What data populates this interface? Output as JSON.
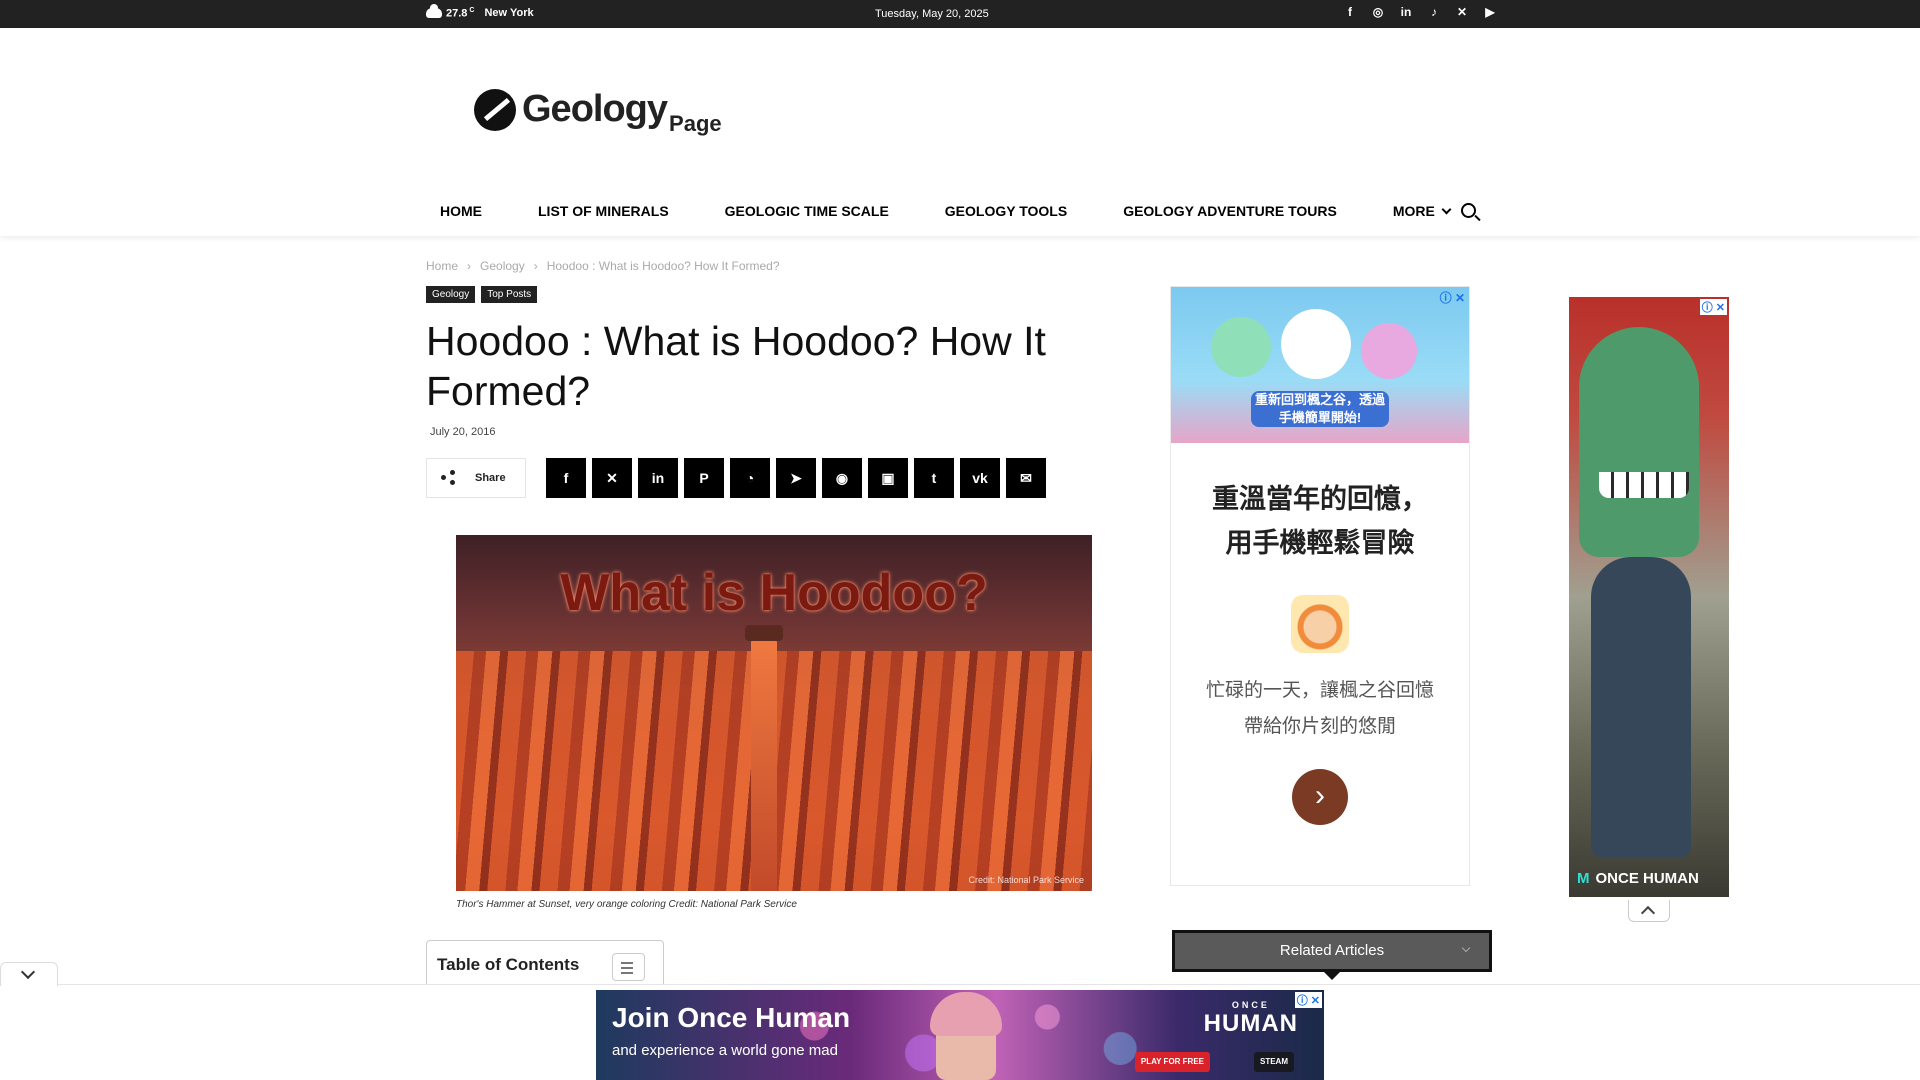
{
  "topbar": {
    "temperature": "27.8",
    "unit": "C",
    "city": "New York",
    "date": "Tuesday, May 20, 2025",
    "social": [
      "f",
      "◎",
      "in",
      "♪",
      "✕",
      "▶"
    ]
  },
  "logo": {
    "main": "Geology",
    "sub": "Page"
  },
  "nav": {
    "items": [
      "HOME",
      "LIST OF MINERALS",
      "GEOLOGIC TIME SCALE",
      "GEOLOGY TOOLS",
      "GEOLOGY ADVENTURE TOURS"
    ],
    "more": "MORE"
  },
  "breadcrumb": [
    "Home",
    "Geology",
    "Hoodoo : What is Hoodoo? How It Formed?"
  ],
  "categories": [
    "Geology",
    "Top Posts"
  ],
  "article": {
    "title": "Hoodoo : What is Hoodoo? How It Formed?",
    "date": "July 20, 2016"
  },
  "share": {
    "label": "Share",
    "buttons": [
      "f",
      "✕",
      "in",
      "P",
      "◔",
      "➤",
      "◉",
      "▣",
      "t",
      "vk",
      "✉"
    ]
  },
  "feature_image": {
    "overlay_text": "What is Hoodoo?",
    "credit": "Credit: National Park Service",
    "caption": "Thor's Hammer at Sunset, very orange coloring Credit: National Park Service"
  },
  "toc": {
    "title": "Table of Contents"
  },
  "ad_right": {
    "banner_text": "重新回到楓之谷，透過手機簡單開始!",
    "headline_line1": "重溫當年的回憶，",
    "headline_line2": "用手機輕鬆冒險",
    "desc_line1": "忙碌的一天，讓楓之谷回憶",
    "desc_line2": "帶給你片刻的悠閒",
    "arrow": "›"
  },
  "ad_skyscraper": {
    "brand": "ONCE HUMAN"
  },
  "related": {
    "label": "Related Articles"
  },
  "bottom_ad": {
    "headline": "Join Once Human",
    "sub": "and experience a world gone mad",
    "brand_small": "ONCE",
    "brand": "HUMAN",
    "play_free": "PLAY FOR FREE",
    "steam": "STEAM"
  },
  "colors": {
    "topbar": "#222222",
    "accent": "#000000",
    "ad_link": "#1a73e8"
  }
}
